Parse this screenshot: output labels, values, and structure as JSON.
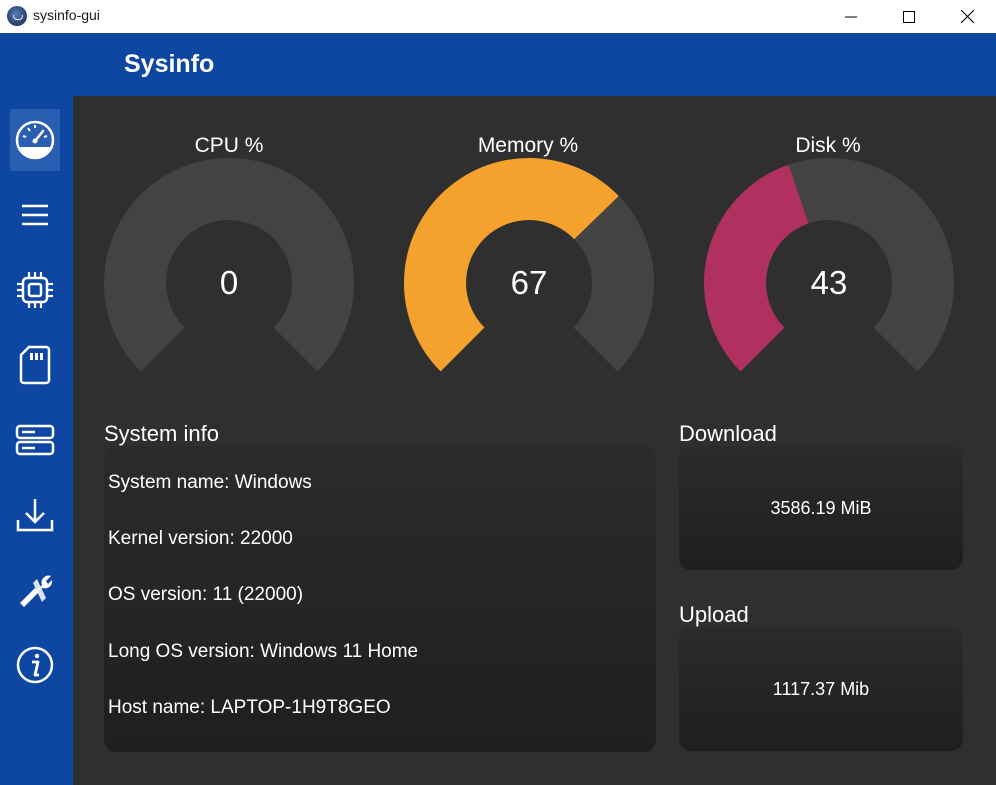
{
  "window": {
    "title": "sysinfo-gui",
    "minimize_icon": "minimize-icon",
    "maximize_icon": "maximize-icon",
    "close_icon": "close-icon"
  },
  "header": {
    "title": "Sysinfo"
  },
  "sidebar": {
    "items": [
      {
        "icon": "dashboard-gauge-icon",
        "active": true
      },
      {
        "icon": "menu-list-icon"
      },
      {
        "icon": "cpu-chip-icon"
      },
      {
        "icon": "memory-card-icon"
      },
      {
        "icon": "storage-server-icon"
      },
      {
        "icon": "download-icon"
      },
      {
        "icon": "tools-wrench-icon"
      },
      {
        "icon": "info-icon"
      }
    ],
    "accent": "#0d47a1",
    "active_bg": "#2a5eb3"
  },
  "gauges": {
    "cpu": {
      "label": "CPU %",
      "value": "0",
      "percent": 0,
      "color": "#f4a22d"
    },
    "memory": {
      "label": "Memory %",
      "value": "67",
      "percent": 67,
      "color": "#f4a22d"
    },
    "disk": {
      "label": "Disk %",
      "value": "43",
      "percent": 43,
      "color": "#b0305f"
    },
    "track_color": "#434343"
  },
  "system_info": {
    "title": "System info",
    "rows": [
      "System name: Windows",
      "Kernel version: 22000",
      "OS version: 11 (22000)",
      "Long OS version: Windows 11 Home",
      "Host name: LAPTOP-1H9T8GEO"
    ]
  },
  "network": {
    "download": {
      "title": "Download",
      "value": "3586.19 MiB"
    },
    "upload": {
      "title": "Upload",
      "value": "1117.37 Mib"
    }
  }
}
